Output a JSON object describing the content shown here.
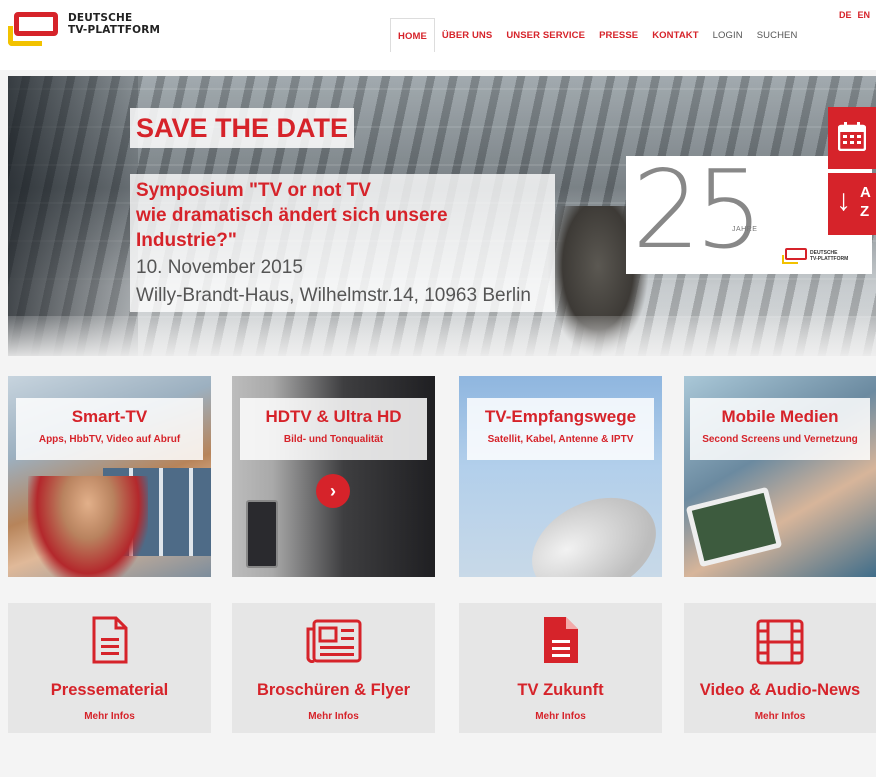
{
  "logo": {
    "line1": "DEUTSCHE",
    "line2": "TV-PLATTFORM"
  },
  "nav": {
    "items": [
      "HOME",
      "ÜBER UNS",
      "UNSER SERVICE",
      "PRESSE",
      "KONTAKT",
      "LOGIN",
      "SUCHEN"
    ]
  },
  "lang": {
    "de": "DE",
    "en": "EN"
  },
  "hero": {
    "save_the_date": "SAVE THE DATE",
    "line1": "Symposium \"TV or not TV",
    "line2": "wie dramatisch ändert sich unsere Industrie?\"",
    "line3": "10. November 2015",
    "line4": "Willy-Brandt-Haus, Wilhelmstr.14, 10963 Berlin",
    "anniversary_number": "25",
    "anniversary_label": "JAHRE",
    "mini_logo_line1": "DEUTSCHE",
    "mini_logo_line2": "TV-PLATTFORM",
    "az_a": "A",
    "az_z": "Z"
  },
  "tiles": [
    {
      "title": "Smart-TV",
      "subtitle": "Apps, HbbTV, Video auf Abruf"
    },
    {
      "title": "HDTV & Ultra HD",
      "subtitle": "Bild- und Tonqualität"
    },
    {
      "title": "TV-Empfangswege",
      "subtitle": "Satellit, Kabel, Antenne & IPTV"
    },
    {
      "title": "Mobile Medien",
      "subtitle": "Second Screens und Vernetzung"
    }
  ],
  "cards": [
    {
      "title": "Pressematerial",
      "link": "Mehr Infos",
      "icon": "document-icon"
    },
    {
      "title": "Broschüren & Flyer",
      "link": "Mehr Infos",
      "icon": "newspaper-icon"
    },
    {
      "title": "TV Zukunft",
      "link": "Mehr Infos",
      "icon": "file-icon"
    },
    {
      "title": "Video & Audio-News",
      "link": "Mehr Infos",
      "icon": "film-icon"
    }
  ],
  "colors": {
    "accent": "#d6232a",
    "logo_yellow": "#f2c200",
    "card_bg": "#e6e6e6"
  }
}
